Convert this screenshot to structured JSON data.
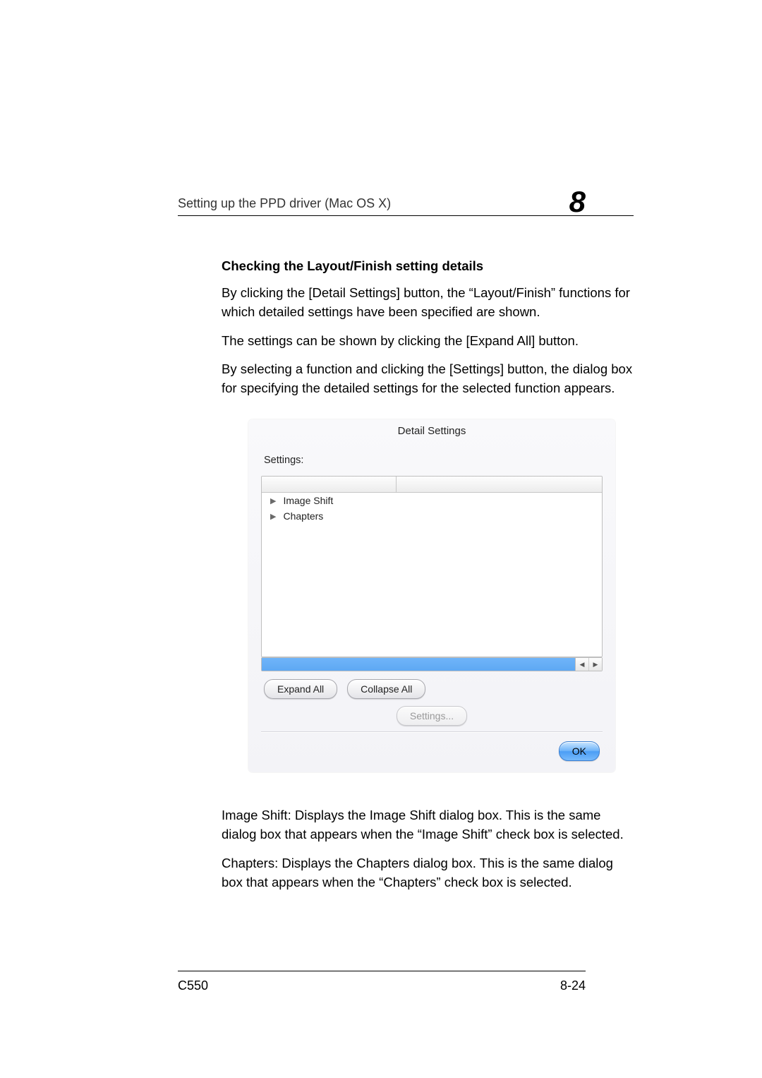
{
  "page": {
    "header_title": "Setting up the PPD driver (Mac OS X)",
    "chapter_number": "8",
    "footer_left": "C550",
    "footer_right": "8-24"
  },
  "body": {
    "subheading": "Checking the Layout/Finish setting details",
    "para1": "By clicking the [Detail Settings] button, the “Layout/Finish” functions for which detailed settings have been specified are shown.",
    "para2": "The settings can be shown by clicking the [Expand All] button.",
    "para3": "By selecting a function and clicking the [Settings] button, the dialog box for specifying the detailed settings for the selected function appears.",
    "para4": "Image Shift: Displays the Image Shift dialog box. This is the same dialog box that appears when the “Image Shift” check box is selected.",
    "para5": "Chapters: Displays the Chapters dialog box. This is the same dialog box that appears when the “Chapters” check box is selected."
  },
  "dialog": {
    "title": "Detail Settings",
    "settings_label": "Settings:",
    "list_items": [
      "Image Shift",
      "Chapters"
    ],
    "buttons": {
      "expand_all": "Expand All",
      "collapse_all": "Collapse All",
      "settings": "Settings...",
      "ok": "OK"
    }
  }
}
